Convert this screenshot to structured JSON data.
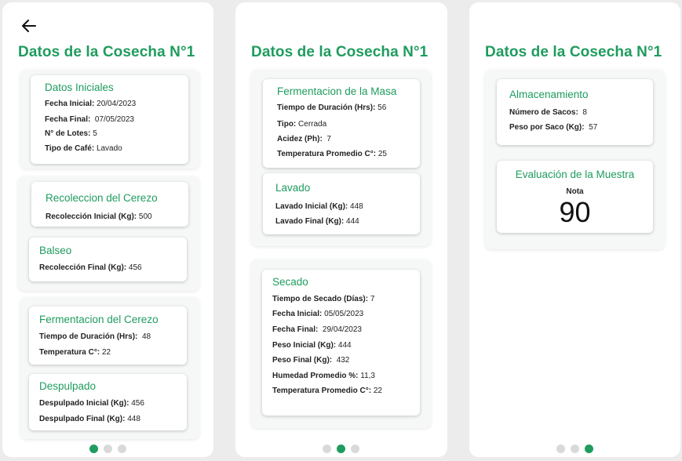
{
  "title": "Datos de la Cosecha N°1",
  "colors": {
    "accent": "#1f9c5e",
    "dot_inactive": "#d9d9d9"
  },
  "screen1": {
    "datos_iniciales": {
      "title": "Datos Iniciales",
      "fecha_inicial": {
        "label": "Fecha Inicial:",
        "value": "20/04/2023"
      },
      "fecha_final": {
        "label": "Fecha Final:",
        "value": "07/05/2023"
      },
      "lotes": {
        "label": "N° de Lotes:",
        "value": "5"
      },
      "tipo_cafe": {
        "label": "Tipo de Café:",
        "value": "Lavado"
      }
    },
    "recoleccion": {
      "title": "Recoleccion del Cerezo",
      "inicial": {
        "label": "Recolección Inicial (Kg):",
        "value": "500"
      }
    },
    "balseo": {
      "title": "Balseo",
      "final": {
        "label": "Recolección Final (Kg):",
        "value": "456"
      }
    },
    "fermentacion_cerezo": {
      "title": "Fermentacion del Cerezo",
      "tiempo": {
        "label": "Tiempo de Duración (Hrs):",
        "value": "48"
      },
      "temperatura": {
        "label": "Temperatura C°:",
        "value": "22"
      }
    },
    "despulpado": {
      "title": "Despulpado",
      "inicial": {
        "label": "Despulpado Inicial (Kg):",
        "value": "456"
      },
      "final": {
        "label": "Despulpado Final (Kg):",
        "value": "448"
      }
    }
  },
  "screen2": {
    "fermentacion_masa": {
      "title": "Fermentacion de la Masa",
      "tiempo": {
        "label": "Tiempo de Duración (Hrs):",
        "value": "56"
      },
      "tipo": {
        "label": "Tipo:",
        "value": "Cerrada"
      },
      "acidez": {
        "label": "Acidez (Ph):",
        "value": "7"
      },
      "temperatura": {
        "label": "Temperatura Promedio C°:",
        "value": "25"
      }
    },
    "lavado": {
      "title": "Lavado",
      "inicial": {
        "label": "Lavado Inicial (Kg):",
        "value": "448"
      },
      "final": {
        "label": "Lavado Final (Kg):",
        "value": "444"
      }
    },
    "secado": {
      "title": "Secado",
      "tiempo": {
        "label": "Tiempo de Secado (Días):",
        "value": "7"
      },
      "fecha_inicial": {
        "label": "Fecha Inicial:",
        "value": "05/05/2023"
      },
      "fecha_final": {
        "label": "Fecha Final:",
        "value": "29/04/2023"
      },
      "peso_inicial": {
        "label": "Peso Inicial (Kg):",
        "value": "444"
      },
      "peso_final": {
        "label": "Peso Final (Kg):",
        "value": "432"
      },
      "humedad": {
        "label": "Humedad Promedio %:",
        "value": "11,3"
      },
      "temperatura": {
        "label": "Temperatura Promedio C°:",
        "value": "22"
      }
    }
  },
  "screen3": {
    "almacenamiento": {
      "title": "Almacenamiento",
      "sacos": {
        "label": "Número de Sacos:",
        "value": "8"
      },
      "peso_saco": {
        "label": "Peso por Saco (Kg):",
        "value": "57"
      }
    },
    "evaluacion": {
      "title": "Evaluación de la Muestra",
      "nota_label": "Nota",
      "nota_value": "90"
    }
  },
  "pagination": {
    "pages": 3
  }
}
